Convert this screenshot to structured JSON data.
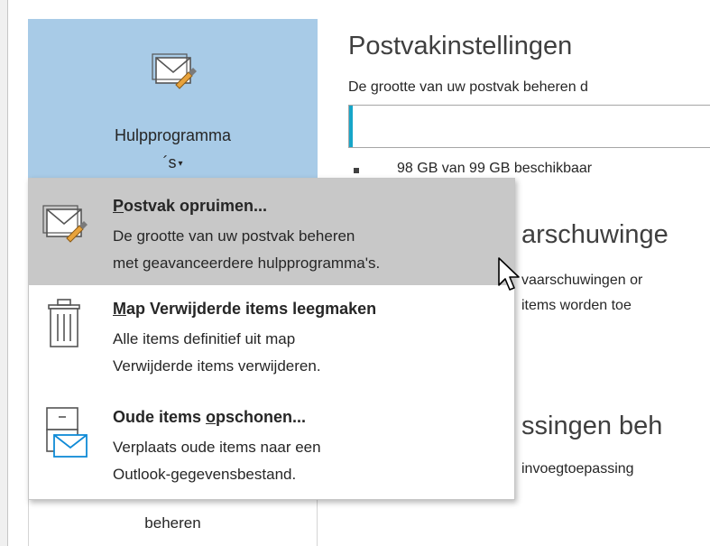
{
  "tools": {
    "label_line1": "Hulpprogramma",
    "label_line2": "´s",
    "caret": "▾"
  },
  "mailbox": {
    "title": "Postvakinstellingen",
    "description": "De grootte van uw postvak beheren d",
    "quota_text": "98 GB van 99 GB beschikbaar",
    "quota_used_fraction": 0.01
  },
  "right_sections": {
    "warnings_heading": "arschuwinge",
    "warnings_line1": "vaarschuwingen or",
    "warnings_line2": "items worden toe",
    "addins_heading": "ssingen beh",
    "addins_line1": "invoegtoepassing"
  },
  "menu": {
    "items": [
      {
        "title_underlined": "P",
        "title_rest": "ostvak opruimen...",
        "line1": "De grootte van uw postvak beheren",
        "line2": "met geavanceerdere hulpprogramma's."
      },
      {
        "title_underlined": "M",
        "title_rest": "ap Verwijderde items leegmaken",
        "line1": "Alle items definitief uit map",
        "line2": "Verwijderde items verwijderen."
      },
      {
        "title_before": "Oude items ",
        "title_underlined": "o",
        "title_rest": "pschonen...",
        "line1": "Verplaats oude items naar een",
        "line2": "Outlook-gegevensbestand."
      }
    ]
  },
  "bottom_tile": {
    "label": "beheren"
  },
  "colors": {
    "tools_bg": "#a8cbe7",
    "menu_hover": "#c8c8c8",
    "quota_fill": "#17a6c9",
    "icon_accent": "#0f8ad6",
    "brush": "#e8a33c"
  }
}
